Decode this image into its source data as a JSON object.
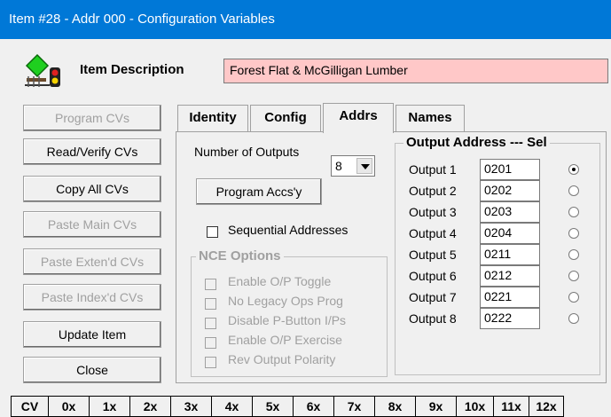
{
  "window": {
    "title": "Item #28 - Addr 000 - Configuration Variables"
  },
  "item": {
    "description_label": "Item Description",
    "description_value": "Forest Flat & McGilligan Lumber"
  },
  "left_buttons": [
    {
      "label": "Program CVs",
      "enabled": false
    },
    {
      "label": "Read/Verify CVs",
      "enabled": true
    },
    {
      "label": "Copy All CVs",
      "enabled": true
    },
    {
      "label": "Paste Main CVs",
      "enabled": false
    },
    {
      "label": "Paste Exten'd CVs",
      "enabled": false
    },
    {
      "label": "Paste Index'd CVs",
      "enabled": false
    },
    {
      "label": "Update Item",
      "enabled": true
    },
    {
      "label": "Close",
      "enabled": true
    }
  ],
  "tabs": [
    {
      "label": "Identity",
      "active": false
    },
    {
      "label": "Config",
      "active": false
    },
    {
      "label": "Addrs",
      "active": true
    },
    {
      "label": "Names",
      "active": false
    }
  ],
  "addrs": {
    "num_outputs_label": "Number of Outputs",
    "num_outputs_value": "8",
    "program_button": "Program Accs'y",
    "sequential_label": "Sequential Addresses",
    "sequential_checked": false,
    "nce_title": "NCE Options",
    "nce_options": [
      "Enable O/P Toggle",
      "No Legacy Ops Prog",
      "Disable P-Button I/Ps",
      "Enable O/P Exercise",
      "Rev Output Polarity"
    ],
    "output_group_title": "Output Address --- Sel",
    "outputs": [
      {
        "label": "Output 1",
        "address": "0201",
        "selected": true
      },
      {
        "label": "Output 2",
        "address": "0202",
        "selected": false
      },
      {
        "label": "Output 3",
        "address": "0203",
        "selected": false
      },
      {
        "label": "Output 4",
        "address": "0204",
        "selected": false
      },
      {
        "label": "Output 5",
        "address": "0211",
        "selected": false
      },
      {
        "label": "Output 6",
        "address": "0212",
        "selected": false
      },
      {
        "label": "Output 7",
        "address": "0221",
        "selected": false
      },
      {
        "label": "Output 8",
        "address": "0222",
        "selected": false
      }
    ]
  },
  "cv_table": {
    "headers": [
      "CV",
      "0x",
      "1x",
      "2x",
      "3x",
      "4x",
      "5x",
      "6x",
      "7x",
      "8x",
      "9x",
      "10x",
      "11x",
      "12x"
    ]
  },
  "colors": {
    "titlebar": "#0078d7",
    "description_bg": "#ffc8c8"
  }
}
